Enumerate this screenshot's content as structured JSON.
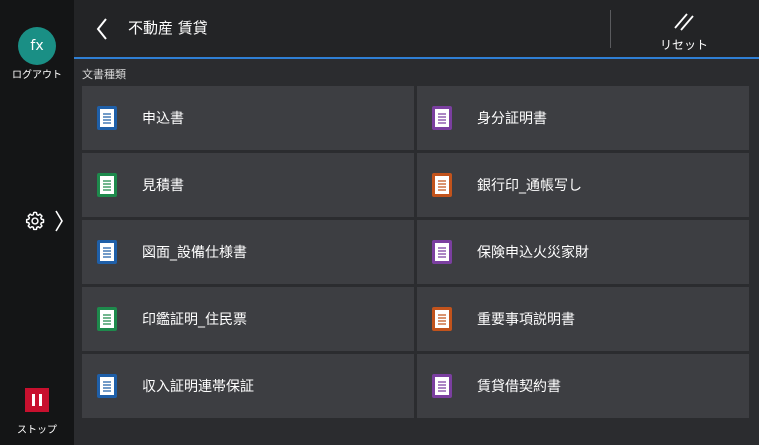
{
  "sidebar": {
    "avatar_text": "fx",
    "logout_label": "ログアウト",
    "stop_label": "ストップ"
  },
  "header": {
    "title": "不動産 賃貸",
    "reset_label": "リセット"
  },
  "section_label": "文書種類",
  "colors": {
    "blue": "#1f5fa8",
    "green": "#1e8a4c",
    "purple": "#7b3fa0",
    "orange": "#c2531c",
    "accent": "#2f7fd4"
  },
  "documents": [
    {
      "label": "申込書",
      "icon": "blue-document-icon",
      "color": "#1f5fa8"
    },
    {
      "label": "身分証明書",
      "icon": "purple-document-icon",
      "color": "#7b3fa0"
    },
    {
      "label": "見積書",
      "icon": "green-document-icon",
      "color": "#1e8a4c"
    },
    {
      "label": "銀行印_通帳写し",
      "icon": "orange-document-icon",
      "color": "#c2531c"
    },
    {
      "label": "図面_設備仕様書",
      "icon": "blue-document-icon",
      "color": "#1f5fa8"
    },
    {
      "label": "保険申込火災家財",
      "icon": "purple-document-icon",
      "color": "#7b3fa0"
    },
    {
      "label": "印鑑証明_住民票",
      "icon": "green-document-icon",
      "color": "#1e8a4c"
    },
    {
      "label": "重要事項説明書",
      "icon": "orange-document-icon",
      "color": "#c2531c"
    },
    {
      "label": "収入証明連帯保証",
      "icon": "blue-document-icon",
      "color": "#1f5fa8"
    },
    {
      "label": "賃貸借契約書",
      "icon": "purple-document-icon",
      "color": "#7b3fa0"
    }
  ]
}
